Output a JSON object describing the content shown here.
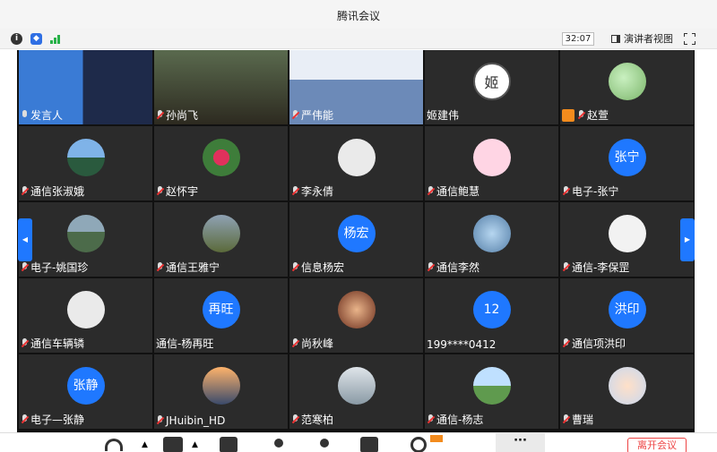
{
  "window": {
    "title": "腾讯会议"
  },
  "infobar": {
    "timer": "32:07",
    "speaker_view_label": "演讲者视图"
  },
  "participants": [
    {
      "name": "发言人",
      "avatar": "video-classroom",
      "mic": "on"
    },
    {
      "name": "孙尚飞",
      "avatar": "video-meeting-room",
      "mic": "muted"
    },
    {
      "name": "严伟能",
      "avatar": "video-person",
      "mic": "muted"
    },
    {
      "name": "姬建伟",
      "avatar": "seal-ji",
      "seal_text": "姬",
      "mic": "none"
    },
    {
      "name": "赵萱",
      "avatar": "photo-flowers",
      "mic": "muted",
      "badge": "user"
    },
    {
      "name": "通信张淑娥",
      "avatar": "photo-lake",
      "mic": "muted"
    },
    {
      "name": "赵怀宇",
      "avatar": "photo-roses",
      "mic": "muted"
    },
    {
      "name": "李永倩",
      "avatar": "default-person",
      "mic": "muted"
    },
    {
      "name": "通信鲍慧",
      "avatar": "pink-sticker",
      "mic": "muted"
    },
    {
      "name": "电子-张宁",
      "avatar_text": "张宁",
      "mic": "muted"
    },
    {
      "name": "电子-姚国珍",
      "avatar": "photo-pond",
      "mic": "muted"
    },
    {
      "name": "通信王雅宁",
      "avatar": "photo-tree",
      "mic": "muted"
    },
    {
      "name": "信息杨宏",
      "avatar_text": "杨宏",
      "mic": "muted"
    },
    {
      "name": "通信李然",
      "avatar": "photo-globe",
      "mic": "muted"
    },
    {
      "name": "通信-李保罡",
      "avatar": "photo-cartoon",
      "mic": "muted"
    },
    {
      "name": "通信车辆辚",
      "avatar": "default-person",
      "mic": "muted"
    },
    {
      "name": "通信-杨再旺",
      "avatar_text": "再旺",
      "mic": "none"
    },
    {
      "name": "尚秋峰",
      "avatar": "photo-brown",
      "mic": "muted"
    },
    {
      "name": "199****0412",
      "avatar_text": "12",
      "mic": "none"
    },
    {
      "name": "通信项洪印",
      "avatar_text": "洪印",
      "mic": "muted"
    },
    {
      "name": "电子—张静",
      "avatar_text": "张静",
      "mic": "muted"
    },
    {
      "name": "JHuibin_HD",
      "avatar": "photo-tower",
      "mic": "muted"
    },
    {
      "name": "范寒柏",
      "avatar": "photo-dock",
      "mic": "muted"
    },
    {
      "name": "通信-杨志",
      "avatar": "photo-field",
      "mic": "muted"
    },
    {
      "name": "曹瑞",
      "avatar": "photo-child",
      "mic": "muted"
    }
  ],
  "toolbar": {
    "leave_label": "离开会议"
  },
  "colors": {
    "tile_bg": "#2b2b2b",
    "accent": "#1f78ff",
    "danger": "#e44444"
  }
}
